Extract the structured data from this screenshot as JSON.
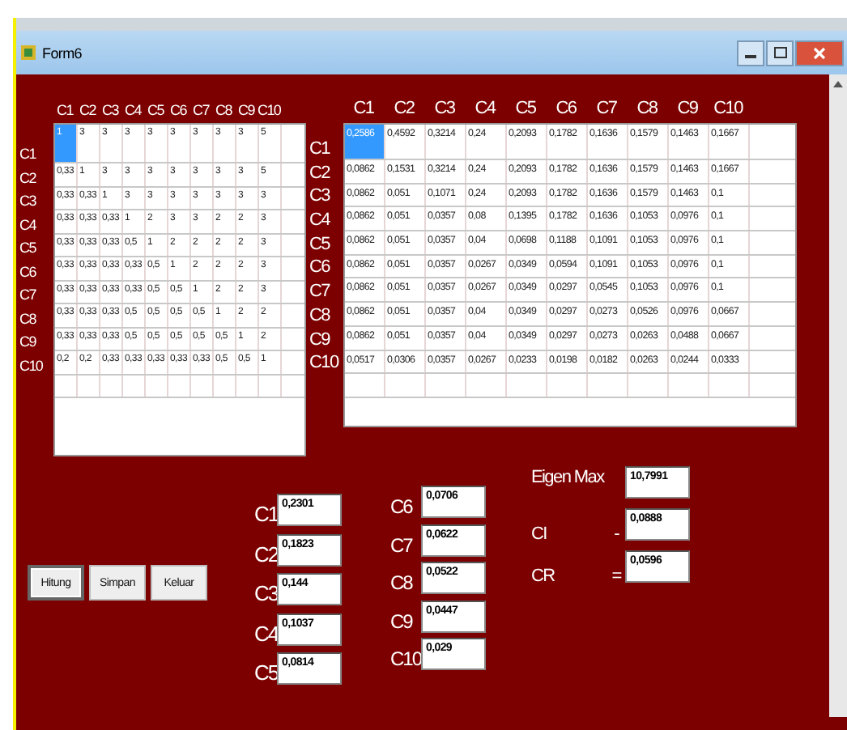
{
  "window": {
    "title": "Form6"
  },
  "matrix_left": {
    "columns": [
      "C1",
      "C2",
      "C3",
      "C4",
      "C5",
      "C6",
      "C7",
      "C8",
      "C9",
      "C10"
    ],
    "rows": [
      {
        "label": "C1",
        "selected": true,
        "cells": [
          "1",
          "3",
          "3",
          "3",
          "3",
          "3",
          "3",
          "3",
          "3",
          "5"
        ]
      },
      {
        "label": "C2",
        "selected": false,
        "cells": [
          "0,33",
          "1",
          "3",
          "3",
          "3",
          "3",
          "3",
          "3",
          "3",
          "5"
        ]
      },
      {
        "label": "C3",
        "selected": false,
        "cells": [
          "0,33",
          "0,33",
          "1",
          "3",
          "3",
          "3",
          "3",
          "3",
          "3",
          "3"
        ]
      },
      {
        "label": "C4",
        "selected": false,
        "cells": [
          "0,33",
          "0,33",
          "0,33",
          "1",
          "2",
          "3",
          "3",
          "2",
          "2",
          "3"
        ]
      },
      {
        "label": "C5",
        "selected": false,
        "cells": [
          "0,33",
          "0,33",
          "0,33",
          "0,5",
          "1",
          "2",
          "2",
          "2",
          "2",
          "3"
        ]
      },
      {
        "label": "C6",
        "selected": false,
        "cells": [
          "0,33",
          "0,33",
          "0,33",
          "0,33",
          "0,5",
          "1",
          "2",
          "2",
          "2",
          "3"
        ]
      },
      {
        "label": "C7",
        "selected": false,
        "cells": [
          "0,33",
          "0,33",
          "0,33",
          "0,33",
          "0,5",
          "0,5",
          "1",
          "2",
          "2",
          "3"
        ]
      },
      {
        "label": "C8",
        "selected": false,
        "cells": [
          "0,33",
          "0,33",
          "0,33",
          "0,5",
          "0,5",
          "0,5",
          "0,5",
          "1",
          "2",
          "2"
        ]
      },
      {
        "label": "C9",
        "selected": false,
        "cells": [
          "0,33",
          "0,33",
          "0,33",
          "0,5",
          "0,5",
          "0,5",
          "0,5",
          "0,5",
          "1",
          "2"
        ]
      },
      {
        "label": "C10",
        "selected": false,
        "cells": [
          "0,2",
          "0,2",
          "0,33",
          "0,33",
          "0,33",
          "0,33",
          "0,33",
          "0,5",
          "0,5",
          "1"
        ]
      }
    ]
  },
  "matrix_right": {
    "columns": [
      "C1",
      "C2",
      "C3",
      "C4",
      "C5",
      "C6",
      "C7",
      "C8",
      "C9",
      "C10"
    ],
    "rows": [
      {
        "label": "C1",
        "selected": true,
        "cells": [
          "0,2586",
          "0,4592",
          "0,3214",
          "0,24",
          "0,2093",
          "0,1782",
          "0,1636",
          "0,1579",
          "0,1463",
          "0,1667"
        ]
      },
      {
        "label": "C2",
        "selected": false,
        "cells": [
          "0,0862",
          "0,1531",
          "0,3214",
          "0,24",
          "0,2093",
          "0,1782",
          "0,1636",
          "0,1579",
          "0,1463",
          "0,1667"
        ]
      },
      {
        "label": "C3",
        "selected": false,
        "cells": [
          "0,0862",
          "0,051",
          "0,1071",
          "0,24",
          "0,2093",
          "0,1782",
          "0,1636",
          "0,1579",
          "0,1463",
          "0,1"
        ]
      },
      {
        "label": "C4",
        "selected": false,
        "cells": [
          "0,0862",
          "0,051",
          "0,0357",
          "0,08",
          "0,1395",
          "0,1782",
          "0,1636",
          "0,1053",
          "0,0976",
          "0,1"
        ]
      },
      {
        "label": "C5",
        "selected": false,
        "cells": [
          "0,0862",
          "0,051",
          "0,0357",
          "0,04",
          "0,0698",
          "0,1188",
          "0,1091",
          "0,1053",
          "0,0976",
          "0,1"
        ]
      },
      {
        "label": "C6",
        "selected": false,
        "cells": [
          "0,0862",
          "0,051",
          "0,0357",
          "0,0267",
          "0,0349",
          "0,0594",
          "0,1091",
          "0,1053",
          "0,0976",
          "0,1"
        ]
      },
      {
        "label": "C7",
        "selected": false,
        "cells": [
          "0,0862",
          "0,051",
          "0,0357",
          "0,0267",
          "0,0349",
          "0,0297",
          "0,0545",
          "0,1053",
          "0,0976",
          "0,1"
        ]
      },
      {
        "label": "C8",
        "selected": false,
        "cells": [
          "0,0862",
          "0,051",
          "0,0357",
          "0,04",
          "0,0349",
          "0,0297",
          "0,0273",
          "0,0526",
          "0,0976",
          "0,0667"
        ]
      },
      {
        "label": "C9",
        "selected": false,
        "cells": [
          "0,0862",
          "0,051",
          "0,0357",
          "0,04",
          "0,0349",
          "0,0297",
          "0,0273",
          "0,0263",
          "0,0488",
          "0,0667"
        ]
      },
      {
        "label": "C10",
        "selected": false,
        "cells": [
          "0,0517",
          "0,0306",
          "0,0357",
          "0,0267",
          "0,0233",
          "0,0198",
          "0,0182",
          "0,0263",
          "0,0244",
          "0,0333"
        ]
      }
    ]
  },
  "buttons": [
    {
      "label": "Hitung",
      "focused": true
    },
    {
      "label": "Simpan",
      "focused": false
    },
    {
      "label": "Keluar",
      "focused": false
    }
  ],
  "weights": [
    {
      "label": "C1",
      "value": "0,2301"
    },
    {
      "label": "C2",
      "value": "0,1823"
    },
    {
      "label": "C3",
      "value": "0,144"
    },
    {
      "label": "C4",
      "value": "0,1037"
    },
    {
      "label": "C5",
      "value": "0,0814"
    },
    {
      "label": "C6",
      "value": "0,0706"
    },
    {
      "label": "C7",
      "value": "0,0622"
    },
    {
      "label": "C8",
      "value": "0,0522"
    },
    {
      "label": "C9",
      "value": "0,0447"
    },
    {
      "label": "C10",
      "value": "0,029"
    }
  ],
  "results": [
    {
      "label": "Eigen Max",
      "value": "10,7991"
    },
    {
      "label": "CI",
      "sign": "-",
      "value": "0,0888"
    },
    {
      "label": "CR",
      "sign": "=",
      "value": "0,0596"
    }
  ]
}
